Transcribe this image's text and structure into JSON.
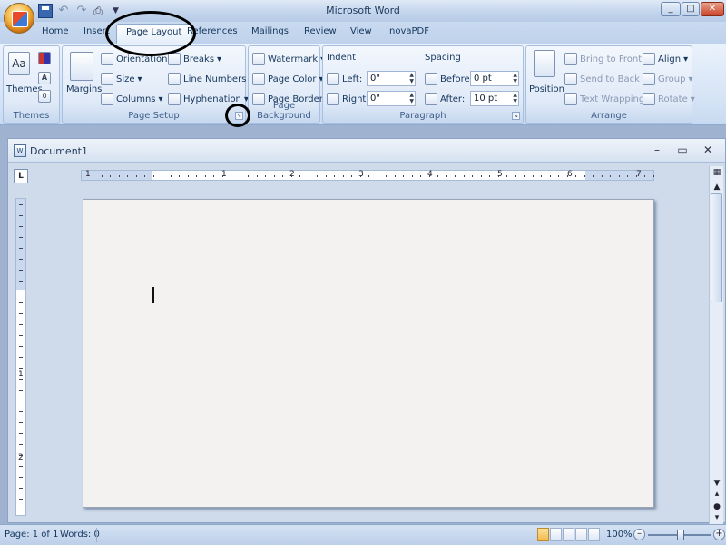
{
  "app": {
    "title": "Microsoft Word"
  },
  "tabs": [
    {
      "label": "Home"
    },
    {
      "label": "Insert"
    },
    {
      "label": "Page Layout",
      "active": true
    },
    {
      "label": "References"
    },
    {
      "label": "Mailings"
    },
    {
      "label": "Review"
    },
    {
      "label": "View"
    },
    {
      "label": "novaPDF"
    }
  ],
  "ribbon": {
    "themes": {
      "title": "Themes",
      "themes_label": "Themes",
      "colors_icon": "theme-colors-icon",
      "fonts_glyph": "A",
      "effects_glyph": "0"
    },
    "page_setup": {
      "title": "Page Setup",
      "margins": "Margins",
      "orientation": "Orientation",
      "size": "Size",
      "columns": "Columns",
      "breaks": "Breaks",
      "line_numbers": "Line Numbers",
      "hyphenation": "Hyphenation"
    },
    "page_background": {
      "title": "Page Background",
      "watermark": "Watermark",
      "page_color": "Page Color",
      "page_borders": "Page Borders"
    },
    "paragraph": {
      "title": "Paragraph",
      "indent_label": "Indent",
      "left_label": "Left:",
      "left_value": "0\"",
      "right_label": "Right:",
      "right_value": "0\"",
      "spacing_label": "Spacing",
      "before_label": "Before:",
      "before_value": "0 pt",
      "after_label": "After:",
      "after_value": "10 pt"
    },
    "arrange": {
      "title": "Arrange",
      "position": "Position",
      "bring_to_front": "Bring to Front",
      "send_to_back": "Send to Back",
      "text_wrapping": "Text Wrapping",
      "align": "Align",
      "group": "Group",
      "rotate": "Rotate"
    }
  },
  "document": {
    "title": "Document1"
  },
  "ruler": {
    "numbers": [
      "1",
      "1",
      "2",
      "3",
      "4",
      "5",
      "6",
      "7"
    ],
    "vertical_numbers": [
      "1",
      "2"
    ]
  },
  "status": {
    "page": "Page: 1 of 1",
    "words": "Words: 0",
    "zoom": "100%",
    "zoom_level": 100
  },
  "annotations": {
    "tab_circle_color": "#000000",
    "launcher_circle_color": "#000000"
  }
}
